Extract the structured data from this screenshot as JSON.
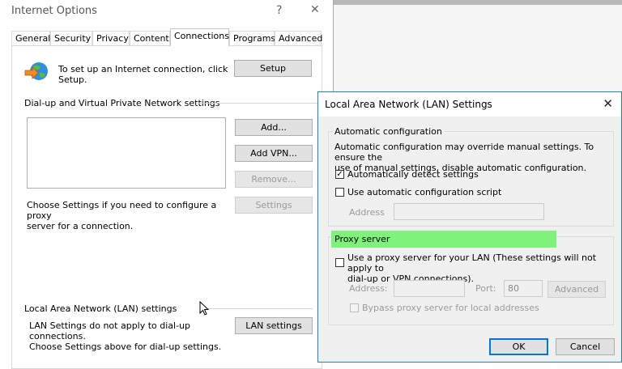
{
  "internet_options": {
    "title": "Internet Options",
    "help_glyph": "?",
    "close_glyph": "✕",
    "tabs": [
      {
        "label": "General"
      },
      {
        "label": "Security"
      },
      {
        "label": "Privacy"
      },
      {
        "label": "Content"
      },
      {
        "label": "Connections"
      },
      {
        "label": "Programs"
      },
      {
        "label": "Advanced"
      }
    ],
    "active_tab": "Connections",
    "setup_text_line1": "To set up an Internet connection, click",
    "setup_text_line2": "Setup.",
    "setup_button": "Setup",
    "dialup_heading": "Dial-up and Virtual Private Network settings",
    "add_button": "Add...",
    "add_vpn_button": "Add VPN...",
    "remove_button": "Remove...",
    "settings_button": "Settings",
    "proxy_hint_line1": "Choose Settings if you need to configure a proxy",
    "proxy_hint_line2": "server for a connection.",
    "lan_heading": "Local Area Network (LAN) settings",
    "lan_text_line1": "LAN Settings do not apply to dial-up connections.",
    "lan_text_line2": "Choose Settings above for dial-up settings.",
    "lan_settings_button": "LAN settings"
  },
  "lan_dialog": {
    "title": "Local Area Network (LAN) Settings",
    "close_glyph": "✕",
    "auto_config": {
      "legend": "Automatic configuration",
      "description_line1": "Automatic configuration may override manual settings.  To ensure the",
      "description_line2": "use of manual settings, disable automatic configuration.",
      "auto_detect_label": "Automatically detect settings",
      "auto_detect_checked": true,
      "check_glyph": "✓",
      "use_script_label": "Use automatic configuration script",
      "use_script_checked": false,
      "address_label": "Address",
      "address_value": ""
    },
    "proxy": {
      "legend": "Proxy server",
      "legend_highlight_color": "#7ef27a",
      "use_proxy_label_line1": "Use a proxy server for your LAN (These settings will not apply to",
      "use_proxy_label_line2": "dial-up or VPN connections).",
      "use_proxy_checked": false,
      "address_label": "Address:",
      "address_value": "",
      "port_label": "Port:",
      "port_value": "80",
      "advanced_button": "Advanced",
      "bypass_label": "Bypass proxy server for local addresses",
      "bypass_checked": false
    },
    "ok_button": "OK",
    "cancel_button": "Cancel"
  }
}
